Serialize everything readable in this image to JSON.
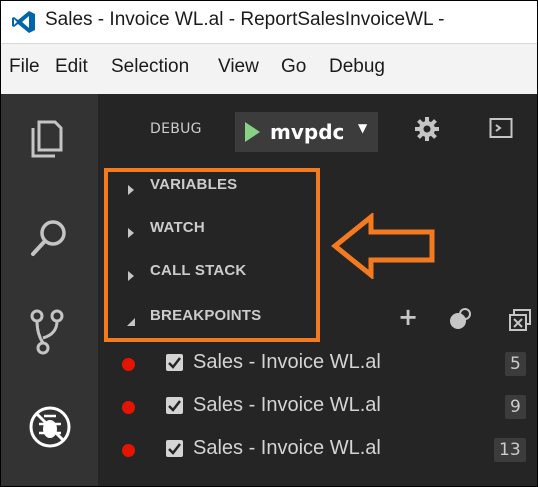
{
  "window": {
    "title": "Sales - Invoice WL.al - ReportSalesInvoiceWL -",
    "app_icon": "visual-studio-code-icon"
  },
  "menu": [
    "File",
    "Edit",
    "Selection",
    "View",
    "Go",
    "Debug"
  ],
  "activity_bar": [
    "explorer-icon",
    "search-icon",
    "source-control-icon",
    "debug-icon"
  ],
  "debug_toolbar": {
    "label": "DEBUG",
    "config_name": "mvpdc",
    "caret": "▼",
    "icons": [
      "play-icon",
      "gear-icon",
      "console-icon"
    ]
  },
  "sections": [
    {
      "label": "VARIABLES",
      "expanded": false
    },
    {
      "label": "WATCH",
      "expanded": false
    },
    {
      "label": "CALL STACK",
      "expanded": false
    },
    {
      "label": "BREAKPOINTS",
      "expanded": true,
      "actions": [
        "+",
        "toggle-breakpoints-icon",
        "remove-all-breakpoints-icon"
      ]
    }
  ],
  "breakpoints": [
    {
      "file": "Sales - Invoice WL.al",
      "line": "5",
      "enabled": true
    },
    {
      "file": "Sales - Invoice WL.al",
      "line": "9",
      "enabled": true
    },
    {
      "file": "Sales - Invoice WL.al",
      "line": "13",
      "enabled": true
    }
  ],
  "annotation": {
    "highlight_color": "#f47a20",
    "arrow_icon": "left-arrow-icon"
  },
  "colors": {
    "sidebar_bg": "#252526",
    "activity_bar_bg": "#333333",
    "play_green": "#89d185",
    "breakpoint_red": "#e51400"
  }
}
